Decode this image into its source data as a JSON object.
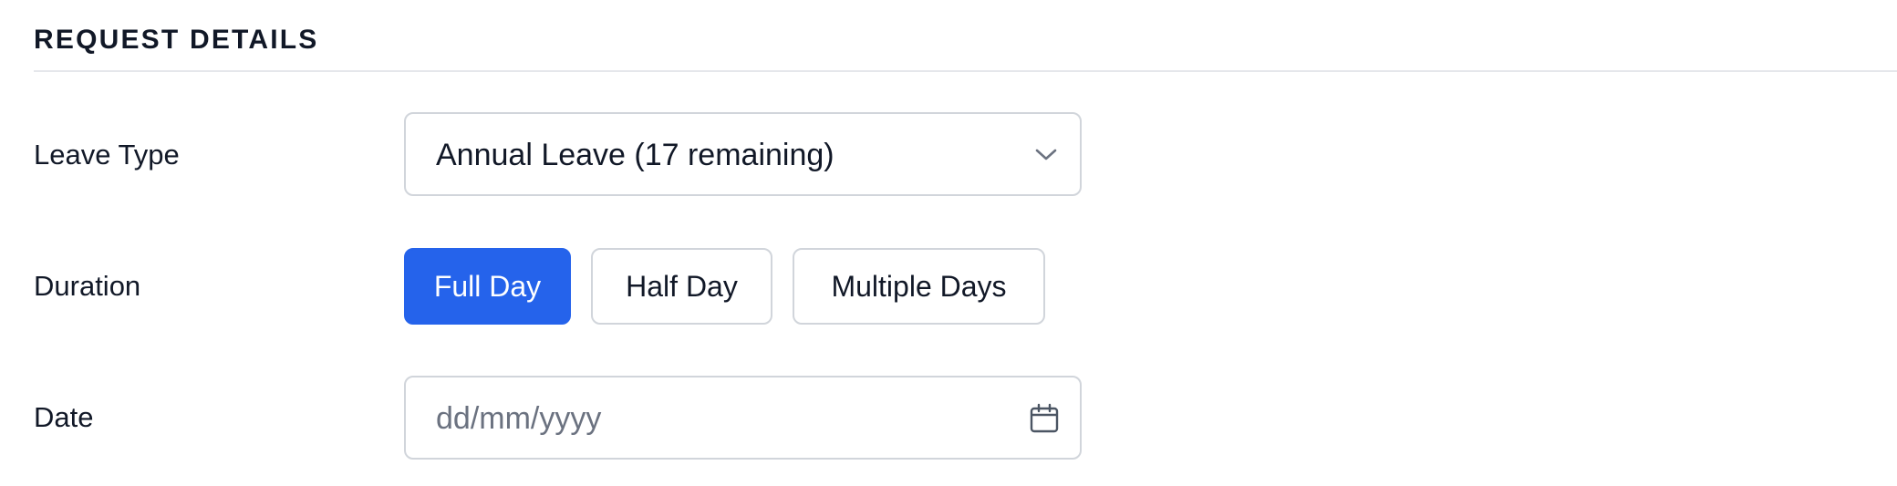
{
  "section": {
    "title": "REQUEST DETAILS"
  },
  "fields": {
    "leave_type": {
      "label": "Leave Type",
      "selected_value": "Annual Leave (17 remaining)",
      "icon": "chevron-down-icon"
    },
    "duration": {
      "label": "Duration",
      "options": [
        "Full Day",
        "Half Day",
        "Multiple Days"
      ],
      "selected": "Full Day"
    },
    "date": {
      "label": "Date",
      "placeholder": "dd/mm/yyyy",
      "value": "",
      "icon": "calendar-icon"
    }
  },
  "colors": {
    "accent": "#2563eb",
    "border": "#d1d5db",
    "divider": "#e5e7eb",
    "text": "#111827",
    "placeholder": "#6b7280"
  }
}
